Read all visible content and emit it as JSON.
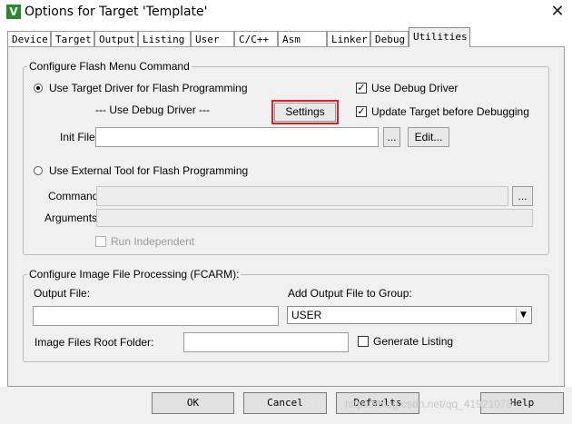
{
  "window": {
    "title": "Options for Target 'Template'",
    "icon": "keil-uvision-icon",
    "close_glyph": "✕"
  },
  "tabs": [
    {
      "label": "Device"
    },
    {
      "label": "Target"
    },
    {
      "label": "Output"
    },
    {
      "label": "Listing"
    },
    {
      "label": "User"
    },
    {
      "label": "C/C++"
    },
    {
      "label": "Asm"
    },
    {
      "label": "Linker"
    },
    {
      "label": "Debug"
    },
    {
      "label": "Utilities",
      "active": true
    }
  ],
  "flash": {
    "legend": "Configure Flash Menu Command",
    "use_target_label": "Use Target Driver for Flash Programming",
    "use_target_selected": true,
    "driver_text": "--- Use Debug Driver ---",
    "settings_label": "Settings",
    "use_debug_driver_label": "Use Debug Driver",
    "use_debug_driver_checked": true,
    "update_target_label": "Update Target before Debugging",
    "update_target_checked": true,
    "init_file_label": "Init File:",
    "init_file_value": "",
    "browse_label": "...",
    "edit_label": "Edit...",
    "use_external_label": "Use External Tool for Flash Programming",
    "use_external_selected": false,
    "command_label": "Command:",
    "command_browse_label": "...",
    "arguments_label": "Arguments:",
    "run_independent_label": "Run Independent",
    "run_independent_checked": false
  },
  "image": {
    "legend": "Configure Image File Processing (FCARM):",
    "output_file_label": "Output File:",
    "output_file_value": "",
    "add_output_label": "Add Output File  to Group:",
    "group_value": "USER",
    "root_folder_label": "Image Files Root Folder:",
    "root_folder_value": "",
    "generate_listing_label": "Generate Listing",
    "generate_listing_checked": false
  },
  "footer": {
    "ok_label": "OK",
    "cancel_label": "Cancel",
    "defaults_label": "Defaults",
    "help_label": "Help",
    "watermark": "https://blog.csdn.net/qq_41921078"
  },
  "colors": {
    "highlight_box": "#e02020",
    "panel_bg": "#f0f0f0"
  }
}
